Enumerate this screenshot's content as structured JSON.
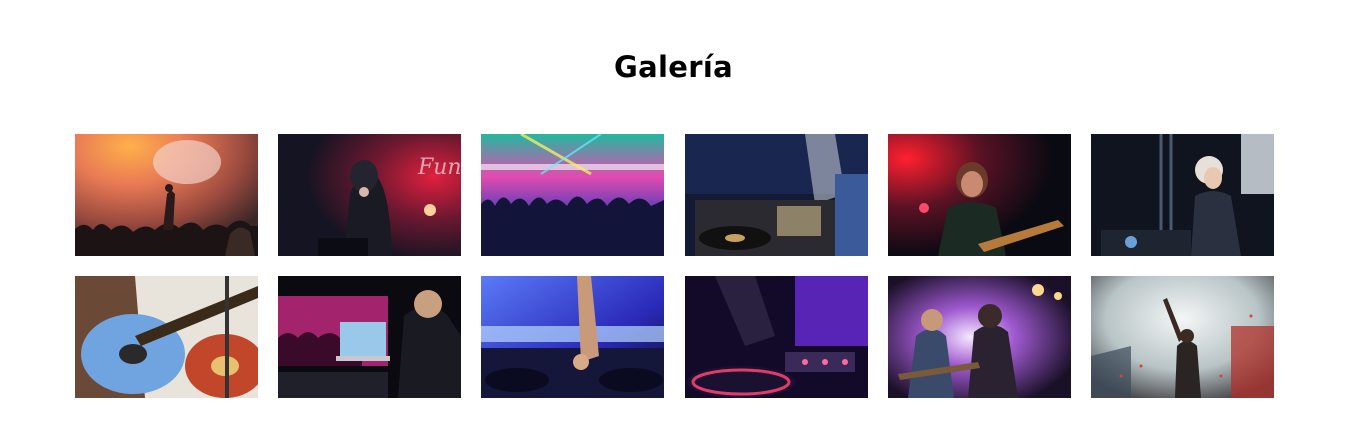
{
  "gallery": {
    "title": "Galería",
    "photos": [
      {
        "subject": "concert-crowd-hands",
        "palette": [
          "#f1a36a",
          "#c65a3a",
          "#3a2a2a"
        ]
      },
      {
        "subject": "singer-red-neon",
        "palette": [
          "#b3123a",
          "#2a2040",
          "#0b0b14"
        ]
      },
      {
        "subject": "festival-crowd-lasers",
        "palette": [
          "#e24bb0",
          "#2a2fa8",
          "#0d0f2e"
        ]
      },
      {
        "subject": "dj-turntables",
        "palette": [
          "#c8a062",
          "#2b3b6e",
          "#0e1224"
        ]
      },
      {
        "subject": "guitarist-red-light",
        "palette": [
          "#d2122a",
          "#3a1a22",
          "#0a0a12"
        ]
      },
      {
        "subject": "dj-headphones-cap",
        "palette": [
          "#6aa0d8",
          "#2a3a5a",
          "#0c0e18"
        ]
      },
      {
        "subject": "guitars-close-up",
        "palette": [
          "#6fa4e0",
          "#c2462a",
          "#1a1a1a"
        ]
      },
      {
        "subject": "dj-laptop-pink-crowd",
        "palette": [
          "#e0309a",
          "#5a2a6a",
          "#0a0a10"
        ]
      },
      {
        "subject": "dj-mixer-blue",
        "palette": [
          "#4a6cf0",
          "#1a2a9a",
          "#0a0c2a"
        ]
      },
      {
        "subject": "turntable-purple",
        "palette": [
          "#7a3ad8",
          "#e23a6a",
          "#0a0818"
        ]
      },
      {
        "subject": "band-spotlight-stage",
        "palette": [
          "#e8c8f0",
          "#7a3aa8",
          "#1a1028"
        ]
      },
      {
        "subject": "singer-smoke-confetti",
        "palette": [
          "#e6ecec",
          "#b0302a",
          "#2a2a2a"
        ]
      }
    ]
  }
}
